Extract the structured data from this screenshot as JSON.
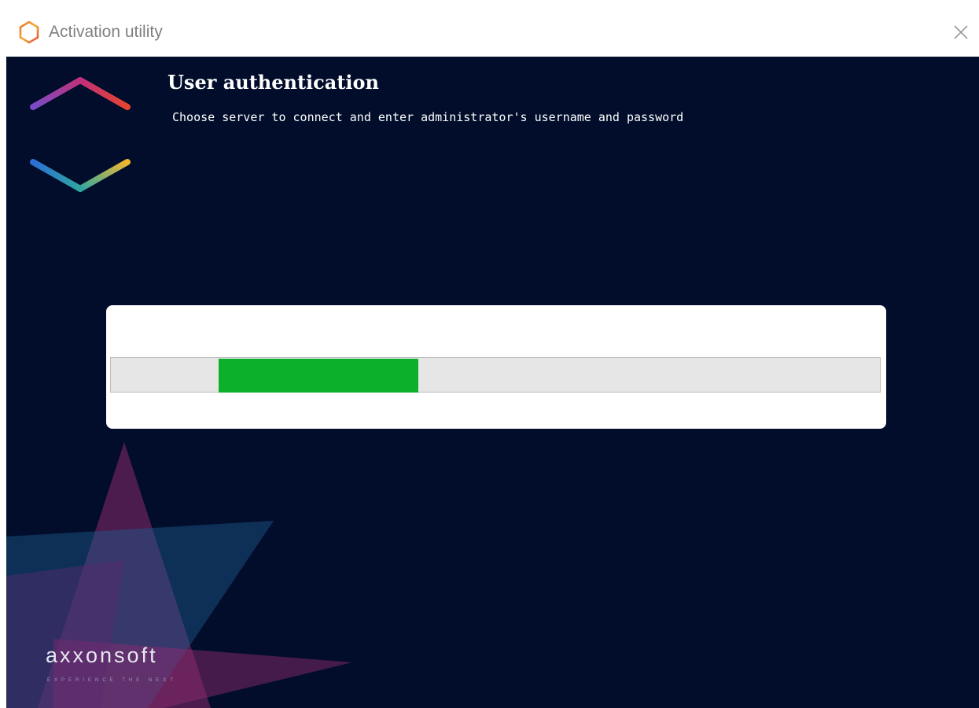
{
  "window": {
    "title": "Activation utility"
  },
  "header": {
    "title": "User authentication",
    "subtitle": "Choose server to connect and enter administrator's username and password"
  },
  "progress": {
    "value_fraction": 0.26,
    "fill_start_fraction": 0.14,
    "fill_color": "#0db02b"
  },
  "brand": {
    "name": "axxonsoft",
    "tagline": "EXPERIENCE THE NEXT"
  },
  "colors": {
    "background": "#010d2b",
    "accent_green": "#0db02b"
  },
  "icons": {
    "title_icon": "hexagon-logo-icon",
    "close_icon": "close-icon",
    "main_logo": "hexagon-logo-icon"
  }
}
